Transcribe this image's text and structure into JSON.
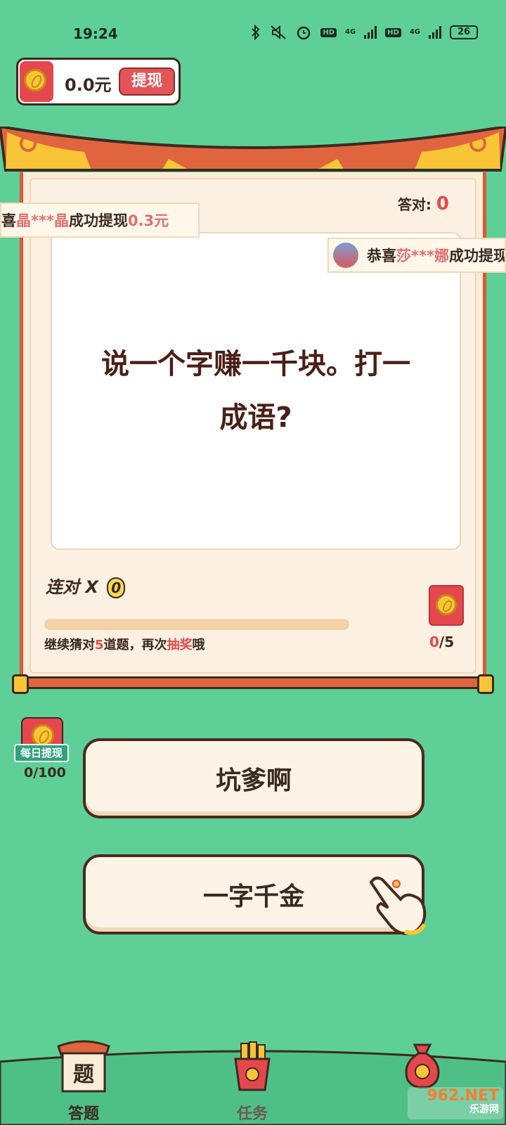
{
  "status_bar": {
    "time": "19:24",
    "net1": "4G",
    "net2": "4G",
    "hd": "HD",
    "battery": "26"
  },
  "wallet": {
    "amount": "0.0元",
    "withdraw_label": "提现"
  },
  "board": {
    "correct_label": "答对:",
    "correct_value": "0",
    "question": "说一个字赚一千块。打一成语?",
    "streak_label": "连对 X",
    "streak_value": "0",
    "progress": 0,
    "hint_pre": "继续猜对",
    "hint_num": "5",
    "hint_mid": "道题，再次",
    "hint_highlight": "抽奖",
    "hint_post": "哦",
    "reward_current": "0",
    "reward_total": "/5"
  },
  "marquee1": {
    "pre": "喜",
    "name": "晶***晶",
    "mid": "成功提现",
    "amount": "0.3元"
  },
  "marquee2": {
    "pre": "恭喜",
    "name": "莎***娜",
    "mid": "成功提现"
  },
  "daily": {
    "tag": "每日提现",
    "count": "0/100"
  },
  "answers": [
    "坑爹啊",
    "一字千金"
  ],
  "nav": {
    "answer_tab": "答题",
    "task_tab": "任务",
    "answer_icon_char": "题"
  },
  "watermark": {
    "main": "962.NET",
    "sub": "乐游网"
  },
  "colors": {
    "background": "#5ecf96",
    "accent_red": "#e44b4b",
    "board": "#fbecd8"
  }
}
